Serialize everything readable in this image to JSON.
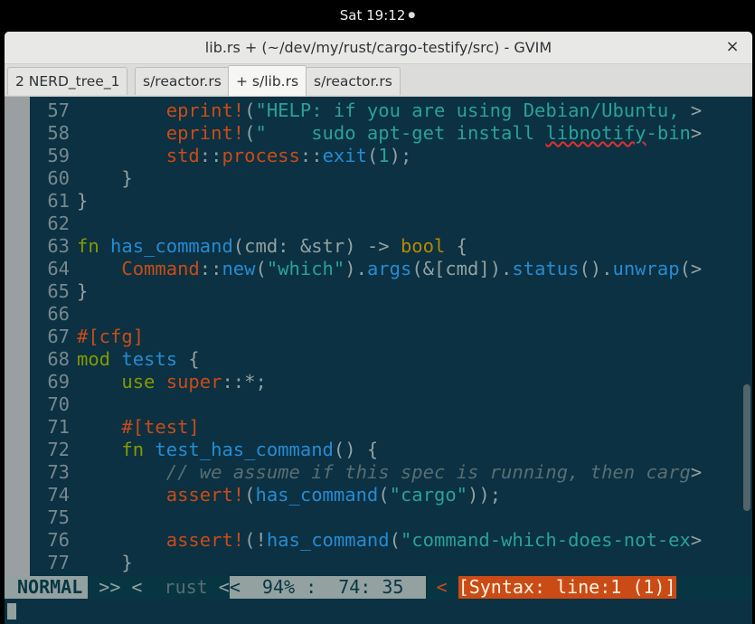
{
  "topbar": {
    "clock": "Sat 19:12",
    "indicator": "●"
  },
  "window": {
    "title": "lib.rs + (~/dev/my/rust/cargo-testify/src) - GVIM",
    "close": "×"
  },
  "tabs": [
    {
      "label": "2 NERD_tree_1"
    },
    {
      "label": "s/reactor.rs"
    },
    {
      "label": "+ s/lib.rs"
    },
    {
      "label": "s/reactor.rs"
    }
  ],
  "code": [
    {
      "n": "57",
      "parts": [
        {
          "t": "        ",
          "c": "white"
        },
        {
          "t": "eprint!",
          "c": "orange"
        },
        {
          "t": "(",
          "c": "white"
        },
        {
          "t": "\"HELP: if you are using Debian/Ubuntu, ",
          "c": "cyan"
        },
        {
          "t": ">",
          "c": "white"
        }
      ]
    },
    {
      "n": "58",
      "parts": [
        {
          "t": "        ",
          "c": "white"
        },
        {
          "t": "eprint!",
          "c": "orange"
        },
        {
          "t": "(",
          "c": "white"
        },
        {
          "t": "\"    ",
          "c": "cyan"
        },
        {
          "t": "sudo",
          "c": "cyan"
        },
        {
          "t": " apt-get install ",
          "c": "cyan"
        },
        {
          "t": "libnotify",
          "c": "cyan squiggle"
        },
        {
          "t": "-bin",
          "c": "cyan"
        },
        {
          "t": ">",
          "c": "white"
        }
      ]
    },
    {
      "n": "59",
      "parts": [
        {
          "t": "        ",
          "c": "white"
        },
        {
          "t": "std",
          "c": "orange"
        },
        {
          "t": "::",
          "c": "white"
        },
        {
          "t": "process",
          "c": "orange"
        },
        {
          "t": "::",
          "c": "white"
        },
        {
          "t": "exit",
          "c": "blue"
        },
        {
          "t": "(",
          "c": "white"
        },
        {
          "t": "1",
          "c": "cyan"
        },
        {
          "t": ");",
          "c": "white"
        }
      ]
    },
    {
      "n": "60",
      "parts": [
        {
          "t": "    }",
          "c": "white"
        }
      ]
    },
    {
      "n": "61",
      "parts": [
        {
          "t": "}",
          "c": "white"
        }
      ]
    },
    {
      "n": "62",
      "parts": [
        {
          "t": "",
          "c": "white"
        }
      ]
    },
    {
      "n": "63",
      "parts": [
        {
          "t": "fn",
          "c": "green"
        },
        {
          "t": " ",
          "c": "white"
        },
        {
          "t": "has_command",
          "c": "blue"
        },
        {
          "t": "(cmd: ",
          "c": "white"
        },
        {
          "t": "&",
          "c": "white"
        },
        {
          "t": "str",
          "c": "white"
        },
        {
          "t": ") -> ",
          "c": "white"
        },
        {
          "t": "bool",
          "c": "yellow"
        },
        {
          "t": " {",
          "c": "white"
        }
      ]
    },
    {
      "n": "64",
      "parts": [
        {
          "t": "    ",
          "c": "white"
        },
        {
          "t": "Command",
          "c": "orange"
        },
        {
          "t": "::",
          "c": "white"
        },
        {
          "t": "new",
          "c": "blue"
        },
        {
          "t": "(",
          "c": "white"
        },
        {
          "t": "\"which\"",
          "c": "cyan"
        },
        {
          "t": ").",
          "c": "white"
        },
        {
          "t": "args",
          "c": "blue"
        },
        {
          "t": "(&[cmd]).",
          "c": "white"
        },
        {
          "t": "status",
          "c": "blue"
        },
        {
          "t": "().",
          "c": "white"
        },
        {
          "t": "unwrap",
          "c": "blue"
        },
        {
          "t": "(>",
          "c": "white"
        }
      ]
    },
    {
      "n": "65",
      "parts": [
        {
          "t": "}",
          "c": "white"
        }
      ]
    },
    {
      "n": "66",
      "parts": [
        {
          "t": "",
          "c": "white"
        }
      ]
    },
    {
      "n": "67",
      "parts": [
        {
          "t": "#[cfg]",
          "c": "orange"
        }
      ]
    },
    {
      "n": "68",
      "parts": [
        {
          "t": "mod",
          "c": "green"
        },
        {
          "t": " ",
          "c": "white"
        },
        {
          "t": "tests",
          "c": "blue"
        },
        {
          "t": " {",
          "c": "white"
        }
      ]
    },
    {
      "n": "69",
      "parts": [
        {
          "t": "    ",
          "c": "white"
        },
        {
          "t": "use",
          "c": "green"
        },
        {
          "t": " ",
          "c": "white"
        },
        {
          "t": "super",
          "c": "orange"
        },
        {
          "t": "::*;",
          "c": "white"
        }
      ]
    },
    {
      "n": "70",
      "parts": [
        {
          "t": "",
          "c": "white"
        }
      ]
    },
    {
      "n": "71",
      "parts": [
        {
          "t": "    ",
          "c": "white"
        },
        {
          "t": "#[test]",
          "c": "orange"
        }
      ]
    },
    {
      "n": "72",
      "parts": [
        {
          "t": "    ",
          "c": "white"
        },
        {
          "t": "fn",
          "c": "green"
        },
        {
          "t": " ",
          "c": "white"
        },
        {
          "t": "test_has_command",
          "c": "blue"
        },
        {
          "t": "() {",
          "c": "white"
        }
      ]
    },
    {
      "n": "73",
      "parts": [
        {
          "t": "        ",
          "c": "white"
        },
        {
          "t": "// we assume if this spec is running, then carg",
          "c": "comment"
        },
        {
          "t": ">",
          "c": "white"
        }
      ]
    },
    {
      "n": "74",
      "parts": [
        {
          "t": "        ",
          "c": "white"
        },
        {
          "t": "assert!",
          "c": "orange"
        },
        {
          "t": "(",
          "c": "white"
        },
        {
          "t": "has_command",
          "c": "blue"
        },
        {
          "t": "(",
          "c": "white"
        },
        {
          "t": "\"cargo\"",
          "c": "cyan"
        },
        {
          "t": "));",
          "c": "white"
        }
      ]
    },
    {
      "n": "75",
      "parts": [
        {
          "t": "",
          "c": "white"
        }
      ]
    },
    {
      "n": "76",
      "parts": [
        {
          "t": "        ",
          "c": "white"
        },
        {
          "t": "assert!",
          "c": "orange"
        },
        {
          "t": "(!",
          "c": "white"
        },
        {
          "t": "has_command",
          "c": "blue"
        },
        {
          "t": "(",
          "c": "white"
        },
        {
          "t": "\"command-which-does-not-ex",
          "c": "cyan"
        },
        {
          "t": ">",
          "c": "white"
        }
      ]
    },
    {
      "n": "77",
      "parts": [
        {
          "t": "    }",
          "c": "white"
        }
      ]
    }
  ],
  "statusline": {
    "mode": "NORMAL",
    "sep1": " >> <  ",
    "filetype": "rust",
    "sep2": " <",
    "position": "<  94% :  74: 35  ",
    "sep3": " < ",
    "warning": "[Syntax: line:1 (1)]"
  },
  "cmdline": {
    "text": ":"
  },
  "colors": {
    "background": "#0b3142",
    "default": "#93a1a1",
    "orange": "#cb4b16",
    "yellow": "#b58900",
    "green": "#859900",
    "blue": "#268bd2",
    "cyan": "#2aa198",
    "comment": "#586e75"
  }
}
